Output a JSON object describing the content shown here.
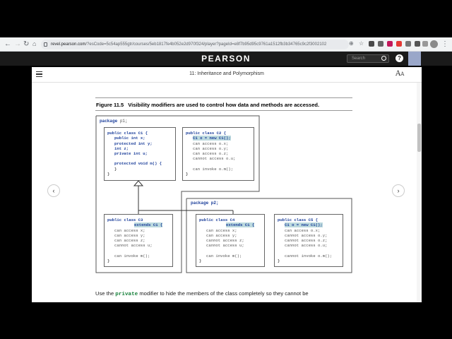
{
  "browser": {
    "url_host": "revel.pearson.com",
    "url_path": "/?esCode=5c54ap555gtr/courses/5eb1817fe4b052e2d970f324/player?pageId=e8f7b95d95c9761a1512fb3b34765c9c2f3002102"
  },
  "header": {
    "brand": "PEARSON",
    "search_placeholder": "Search",
    "help_label": "?"
  },
  "toolbar": {
    "chapter_title": "11: Inheritance and Polymorphism",
    "text_size_label": "A"
  },
  "figure": {
    "number": "Figure 11.5",
    "caption": "Visibility modifiers are used to control how data and methods are accessed.",
    "package_p1": "package p1;",
    "package_p2": "package p2;",
    "c1": {
      "header": "public class C1 {",
      "lines": [
        "public int x;",
        "protected int y;",
        "int z;",
        "private int u;",
        "",
        "protected void m() {",
        "}"
      ],
      "close": "}"
    },
    "c2": {
      "header": "public class C2 {",
      "new_line": "C1 o = new C1();",
      "lines": [
        "can access o.x;",
        "can access o.y;",
        "can access o.z;",
        "cannot access o.u;",
        "",
        "can invoke o.m();"
      ],
      "close": "}"
    },
    "c3": {
      "header": "public class C3",
      "extends": "extends C1 {",
      "lines": [
        "can access x;",
        "can access y;",
        "can access z;",
        "cannot access u;",
        "",
        "can invoke m();"
      ],
      "close": "}"
    },
    "c4": {
      "header": "public class C4",
      "extends": "extends C1 {",
      "lines": [
        "can access x;",
        "can access y;",
        "cannot access z;",
        "cannot access u;",
        "",
        "can invoke m();"
      ],
      "close": "}"
    },
    "c5": {
      "header": "public class C5 {",
      "new_line": "C1 o = new C1();",
      "lines": [
        "can access o.x;",
        "cannot access o.y;",
        "cannot access o.z;",
        "cannot access o.u;",
        "",
        "cannot invoke o.m();"
      ],
      "close": "}"
    }
  },
  "body": {
    "before": "Use the",
    "code": "private",
    "after": "modifier to hide the members of the class completely so they cannot be"
  },
  "nav": {
    "prev": "‹",
    "next": "›"
  }
}
